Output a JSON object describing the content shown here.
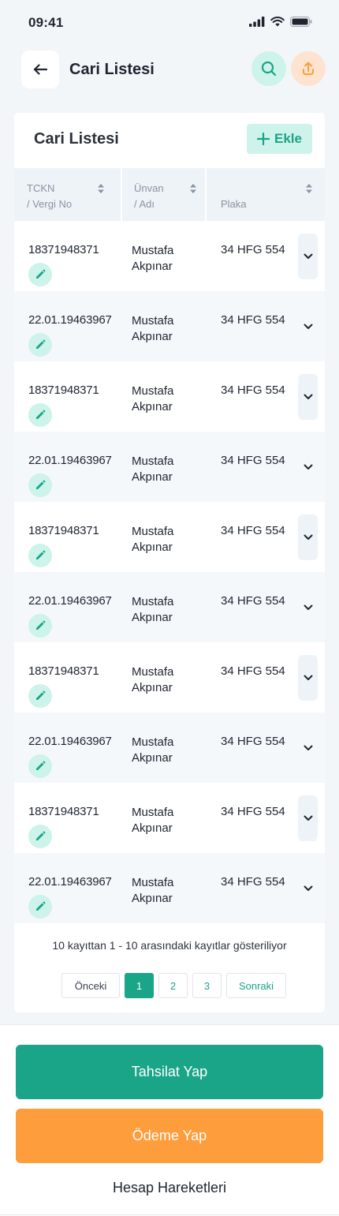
{
  "status_bar": {
    "time": "09:41",
    "icons": [
      "signal-icon",
      "wifi-icon",
      "battery-icon"
    ]
  },
  "app_bar": {
    "title": "Cari Listesi",
    "icons": [
      "back-arrow-icon",
      "search-icon",
      "upload-icon"
    ]
  },
  "card": {
    "title": "Cari Listesi",
    "add_label": "Ekle",
    "columns": [
      {
        "label": "TCKN\n/ Vergi No",
        "sortable": true
      },
      {
        "label": "Ünvan\n/ Adı",
        "sortable": true
      },
      {
        "label": "Plaka",
        "sortable": true
      }
    ],
    "rows": [
      {
        "tc": "18371948371",
        "name_line1": "Mustafa",
        "name_line2": "Akpınar",
        "plate": "34 HFG 554"
      },
      {
        "tc": "22.01.19463967",
        "name_line1": "Mustafa",
        "name_line2": "Akpınar",
        "plate": "34 HFG 554"
      },
      {
        "tc": "18371948371",
        "name_line1": "Mustafa",
        "name_line2": "Akpınar",
        "plate": "34 HFG 554"
      },
      {
        "tc": "22.01.19463967",
        "name_line1": "Mustafa",
        "name_line2": "Akpınar",
        "plate": "34 HFG 554"
      },
      {
        "tc": "18371948371",
        "name_line1": "Mustafa",
        "name_line2": "Akpınar",
        "plate": "34 HFG 554"
      },
      {
        "tc": "22.01.19463967",
        "name_line1": "Mustafa",
        "name_line2": "Akpınar",
        "plate": "34 HFG 554"
      },
      {
        "tc": "18371948371",
        "name_line1": "Mustafa",
        "name_line2": "Akpınar",
        "plate": "34 HFG 554"
      },
      {
        "tc": "22.01.19463967",
        "name_line1": "Mustafa",
        "name_line2": "Akpınar",
        "plate": "34 HFG 554"
      },
      {
        "tc": "18371948371",
        "name_line1": "Mustafa",
        "name_line2": "Akpınar",
        "plate": "34 HFG 554"
      },
      {
        "tc": "22.01.19463967",
        "name_line1": "Mustafa",
        "name_line2": "Akpınar",
        "plate": "34 HFG 554"
      }
    ],
    "pager_info": "10 kayıttan 1 - 10 arasındaki kayıtlar gösteriliyor",
    "pager": {
      "prev": "Önceki",
      "pages": [
        "1",
        "2",
        "3"
      ],
      "active_page": "1",
      "next": "Sonraki"
    }
  },
  "actions": {
    "collect_label": "Tahsilat Yap",
    "pay_label": "Ödeme Yap",
    "history_label": "Hesap Hareketleri"
  },
  "colors": {
    "accent": "#1aa488",
    "accent_light": "#cdf3ea",
    "orange": "#fd9d3b",
    "orange_light": "#fde3d0"
  }
}
